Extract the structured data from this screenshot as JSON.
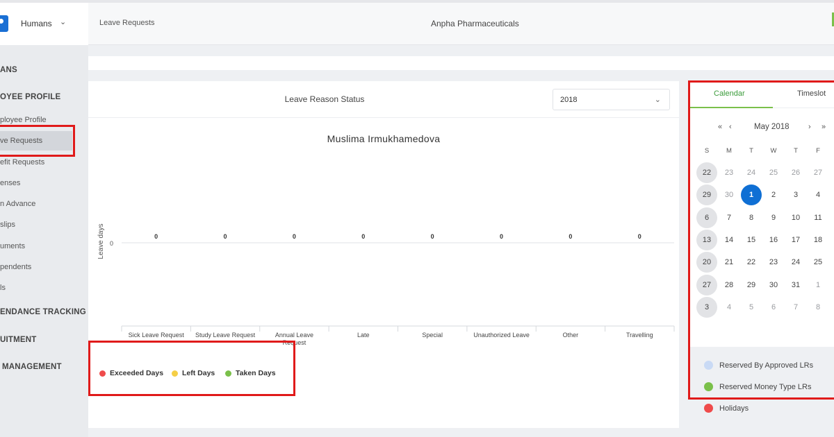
{
  "app": {
    "brand": "Humans"
  },
  "header": {
    "breadcrumb": "Leave Requests",
    "company": "Anpha Pharmaceuticals"
  },
  "sidebar": {
    "sections": [
      "ANS",
      "OYEE PROFILE",
      "ENDANCE TRACKING",
      "UITMENT",
      "MANAGEMENT"
    ],
    "items": [
      "ployee Profile",
      "ve Requests",
      "efit Requests",
      "enses",
      "n Advance",
      "slips",
      "uments",
      "pendents",
      "ls"
    ]
  },
  "card": {
    "title": "Leave Reason Status",
    "year": "2018"
  },
  "chart_data": {
    "type": "bar",
    "title": "Muslima Irmukhamedova",
    "ylabel": "Leave days",
    "xlabel": "",
    "categories": [
      "Sick Leave Request",
      "Study Leave Request",
      "Annual Leave Request",
      "Late",
      "Special",
      "Unauthorized Leave",
      "Other",
      "Travelling"
    ],
    "y_ticks": [
      "0"
    ],
    "data_labels": [
      "0",
      "0",
      "0",
      "0",
      "0",
      "0",
      "0",
      "0"
    ],
    "values": [
      0,
      0,
      0,
      0,
      0,
      0,
      0,
      0
    ],
    "legend": [
      {
        "name": "Exceeded Days",
        "color": "#ef4b4b"
      },
      {
        "name": "Left Days",
        "color": "#f5cf47"
      },
      {
        "name": "Taken Days",
        "color": "#7ac04a"
      }
    ],
    "legend_position": "bottom-left"
  },
  "calendar": {
    "tabs": [
      "Calendar",
      "Timeslot"
    ],
    "nav": {
      "prev_year": "«",
      "prev_month": "‹",
      "next_month": "›",
      "next_year": "»"
    },
    "month_label": "May 2018",
    "weekdays": [
      "S",
      "M",
      "T",
      "W",
      "T",
      "F"
    ],
    "weeks": [
      [
        "22",
        "23",
        "24",
        "25",
        "26",
        "27"
      ],
      [
        "29",
        "30",
        "1",
        "2",
        "3",
        "4"
      ],
      [
        "6",
        "7",
        "8",
        "9",
        "10",
        "11"
      ],
      [
        "13",
        "14",
        "15",
        "16",
        "17",
        "18"
      ],
      [
        "20",
        "21",
        "22",
        "23",
        "24",
        "25"
      ],
      [
        "27",
        "28",
        "29",
        "30",
        "31",
        "1"
      ],
      [
        "3",
        "4",
        "5",
        "6",
        "7",
        "8"
      ]
    ],
    "today": "1",
    "legend": [
      {
        "label": "Reserved By Approved LRs",
        "color": "#c9daf5"
      },
      {
        "label": "Reserved Money Type LRs",
        "color": "#7ac04a"
      },
      {
        "label": "Holidays",
        "color": "#ef4b4b"
      }
    ]
  },
  "colors": {
    "accent": "#0f6fd4",
    "highlight": "#e01a1a",
    "tab_active": "#7ac04a"
  }
}
